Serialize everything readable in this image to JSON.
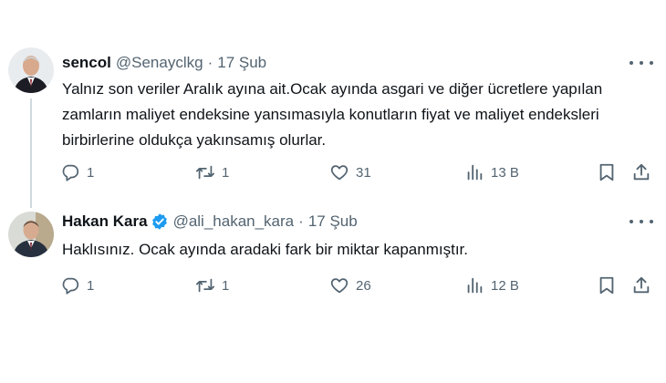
{
  "tweets": [
    {
      "name": "sencol",
      "handle": "@Senayclkg",
      "separator": "·",
      "date": "17 Şub",
      "verified": false,
      "text": "Yalnız son veriler Aralık ayına ait.Ocak ayında asgari ve diğer ücretlere yapılan zamların maliyet endeksine yansımasıyla  konutların fiyat ve maliyet endeksleri birbirlerine oldukça yakınsamış olurlar.",
      "replies": "1",
      "reposts": "1",
      "likes": "31",
      "views": "13 B"
    },
    {
      "name": "Hakan Kara",
      "handle": "@ali_hakan_kara",
      "separator": "·",
      "date": "17 Şub",
      "verified": true,
      "text": "Haklısınız. Ocak ayında aradaki fark bir miktar kapanmıştır.",
      "replies": "1",
      "reposts": "1",
      "likes": "26",
      "views": "12 B"
    }
  ],
  "icons": {
    "reply": "reply-icon",
    "repost": "repost-icon",
    "like": "heart-icon",
    "views": "analytics-icon",
    "bookmark": "bookmark-icon",
    "share": "share-icon",
    "verified": "verified-badge-icon",
    "more": "more-icon"
  },
  "colors": {
    "text": "#0f1419",
    "secondary": "#536471",
    "verified": "#1d9bf0",
    "thread_line": "#cfd9de"
  }
}
